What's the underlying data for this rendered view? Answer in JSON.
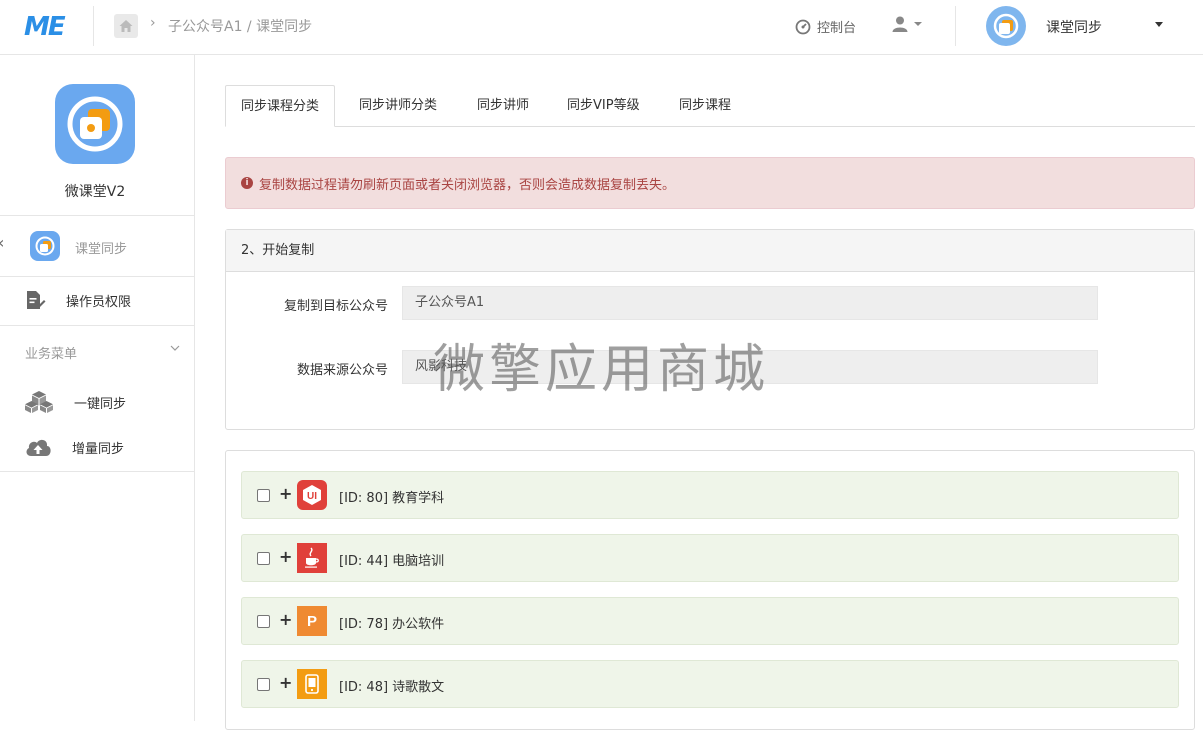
{
  "header": {
    "logo": "ME",
    "breadcrumb": "子公众号A1 / 课堂同步",
    "console_label": "控制台",
    "account_name": "课堂同步"
  },
  "sidebar": {
    "app_name": "微课堂V2",
    "current_app": "课堂同步",
    "operator_label": "操作员权限",
    "section_title": "业务菜单",
    "items": [
      {
        "label": "一键同步",
        "icon": "cubes-icon"
      },
      {
        "label": "增量同步",
        "icon": "cloud-upload-icon"
      }
    ]
  },
  "tabs": [
    {
      "label": "同步课程分类",
      "active": true
    },
    {
      "label": "同步讲师分类",
      "active": false
    },
    {
      "label": "同步讲师",
      "active": false
    },
    {
      "label": "同步VIP等级",
      "active": false
    },
    {
      "label": "同步课程",
      "active": false
    }
  ],
  "alert": {
    "text": "复制数据过程请勿刷新页面或者关闭浏览器，否则会造成数据复制丢失。",
    "color": "#a94442"
  },
  "copy_panel": {
    "title": "2、开始复制",
    "target_label": "复制到目标公众号",
    "target_value": "子公众号A1",
    "source_label": "数据来源公众号",
    "source_value": "风影科技"
  },
  "watermark": "微擎应用商城",
  "categories": [
    {
      "label": "[ID: 80] 教育学科",
      "icon": "ui-icon",
      "color": "#e0403a"
    },
    {
      "label": "[ID: 44] 电脑培训",
      "icon": "java-icon",
      "color": "#e0403a"
    },
    {
      "label": "[ID: 78] 办公软件",
      "icon": "powerpoint-icon",
      "color": "#ef8a32"
    },
    {
      "label": "[ID: 48] 诗歌散文",
      "icon": "phone-icon",
      "color": "#f39c12"
    }
  ]
}
